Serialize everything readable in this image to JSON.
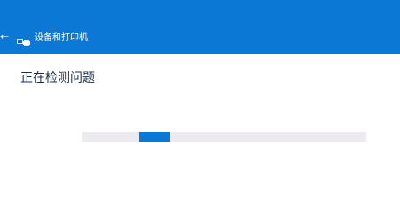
{
  "window": {
    "title": "设备和打印机"
  },
  "header": {
    "back_icon": "back-arrow-icon",
    "app_icon": "devices-printers-icon",
    "accent_color": "#0a78d4"
  },
  "content": {
    "status_text": "正在检测问题"
  },
  "progress": {
    "state": "indeterminate",
    "accent_color": "#0a78d4",
    "track_color": "#eceaef"
  }
}
